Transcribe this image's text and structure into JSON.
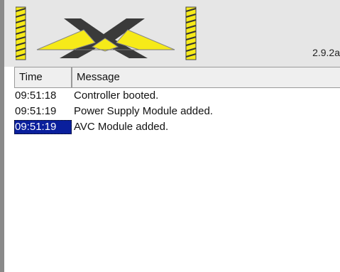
{
  "header": {
    "version": "2.9.2a"
  },
  "log": {
    "columns": {
      "time": "Time",
      "message": "Message"
    },
    "rows": [
      {
        "time": "09:51:18",
        "message": "Controller booted."
      },
      {
        "time": "09:51:19",
        "message": "Power Supply Module added."
      },
      {
        "time": "09:51:19",
        "message": "AVC Module added."
      }
    ],
    "selected_row_index": 2
  },
  "colors": {
    "selection": "#0a1f9c",
    "logo_yellow": "#f6ea19",
    "logo_dark": "#3a3a3a",
    "header_bg": "#e6e6e6"
  }
}
